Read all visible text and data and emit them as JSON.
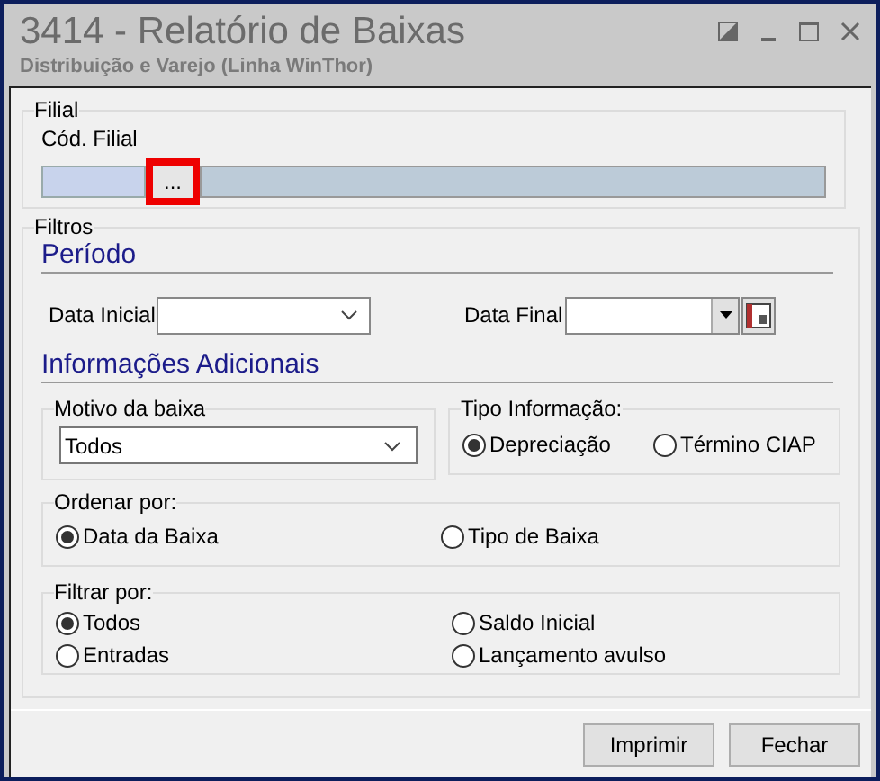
{
  "window": {
    "title": "3414 - Relatório de Baixas",
    "subtitle": "Distribuição e Varejo (Linha WinThor)"
  },
  "filial": {
    "group": "Filial",
    "label": "Cód. Filial",
    "button": "...",
    "highlighted": true
  },
  "filtros": {
    "group": "Filtros",
    "periodo_header": "Período",
    "data_inicial_label": "Data Inicial",
    "data_final_label": "Data Final",
    "info_header": "Informações Adicionais"
  },
  "motivo": {
    "group": "Motivo da baixa",
    "value": "Todos"
  },
  "tipo_informacao": {
    "group": "Tipo Informação:",
    "options": [
      {
        "label": "Depreciação",
        "selected": true
      },
      {
        "label": "Término CIAP",
        "selected": false
      }
    ]
  },
  "ordenar": {
    "group": "Ordenar por:",
    "options": [
      {
        "label": "Data da Baixa",
        "selected": true
      },
      {
        "label": "Tipo de Baixa",
        "selected": false
      }
    ]
  },
  "filtrar": {
    "group": "Filtrar por:",
    "options": [
      {
        "label": "Todos",
        "selected": true
      },
      {
        "label": "Saldo Inicial",
        "selected": false
      },
      {
        "label": "Entradas",
        "selected": false
      },
      {
        "label": "Lançamento avulso",
        "selected": false
      }
    ]
  },
  "buttons": [
    "Imprimir",
    "Fechar"
  ]
}
